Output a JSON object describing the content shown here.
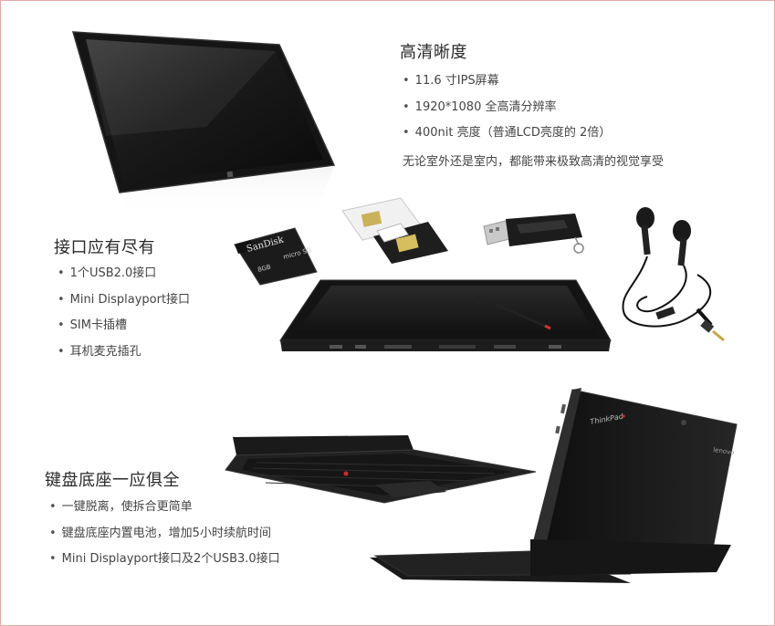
{
  "display": {
    "title": "高清晰度",
    "features": [
      "11.6 寸IPS屏幕",
      "1920*1080 全高清分辨率",
      "400nit 亮度（普通LCD亮度的 2倍）"
    ],
    "note": "无论室外还是室内，都能带来极致高清的视觉享受"
  },
  "ports": {
    "title": "接口应有尽有",
    "features": [
      "1个USB2.0接口",
      "Mini Displayport接口",
      "SIM卡插槽",
      "耳机麦克插孔"
    ]
  },
  "dock": {
    "title": "键盘底座一应俱全",
    "features": [
      "一键脱离，使拆合更简单",
      "键盘底座内置电池，增加5小时续航时间",
      "Mini Displayport接口及2个USB3.0接口"
    ]
  },
  "images": {
    "sd_brand": "SanDisk",
    "sd_capacity": "8GB",
    "sd_micro": "micro SD",
    "tablet_brand": "ThinkPad",
    "tablet_logo": "lenovo"
  }
}
